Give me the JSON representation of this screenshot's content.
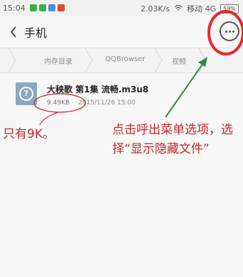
{
  "status_bar": {
    "time": "15:04",
    "speed": "2.03K/s",
    "carrier": "移动 4G",
    "battery": "59%"
  },
  "header": {
    "title": "手机"
  },
  "breadcrumb": [
    "内存目录",
    "QQBrowser",
    "视频"
  ],
  "file": {
    "name": "大秧歌 第1集 流畅.m3u8",
    "size": "9.49KB",
    "date": "2015/11/26 15:00"
  },
  "annotations": {
    "size_note": "只有9K。",
    "menu_note": "点击呼出菜单选项，选择“显示隐藏文件”"
  },
  "colors": {
    "annotation_red": "#c6242a",
    "arrow_green": "#2e8b3e"
  }
}
